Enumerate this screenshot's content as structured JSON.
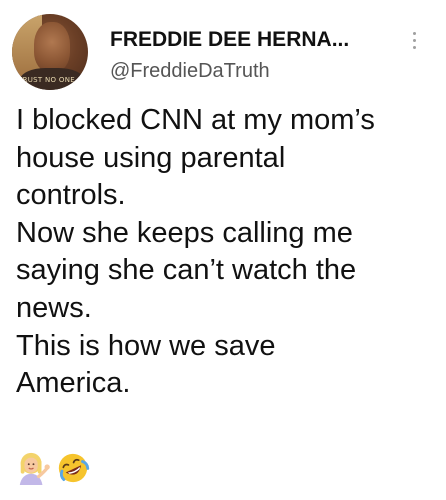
{
  "tweet": {
    "author_name": "FREDDIE DEE HERNA...",
    "author_handle": "@FreddieDaTruth",
    "avatar_caption": "TRUST NO ONE",
    "body_lines": [
      "I blocked CNN at my mom’s",
      "house using parental",
      "controls.",
      "Now she keeps calling me",
      "saying she can’t watch the",
      "news.",
      "This is how we save",
      "America."
    ],
    "emojis": [
      "woman-tipping-hand-icon",
      "rolling-on-floor-laughing-icon"
    ]
  },
  "colors": {
    "text": "#111111",
    "handle": "#555555",
    "background": "#ffffff"
  }
}
